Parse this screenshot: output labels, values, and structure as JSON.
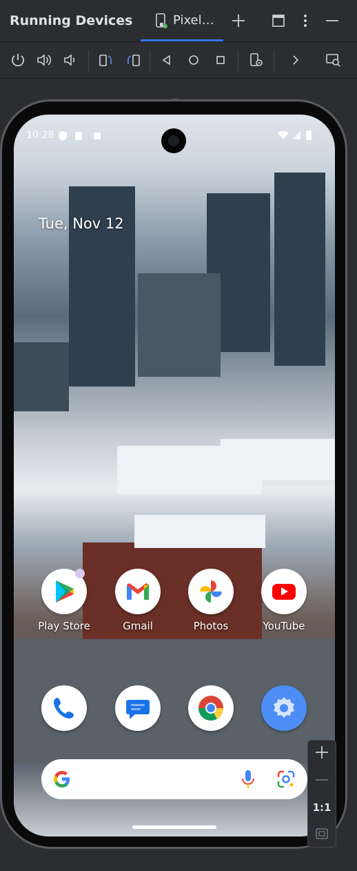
{
  "panel": {
    "title": "Running Devices",
    "tab_label": "Pixel…"
  },
  "toolbar": {
    "items": [
      "power-icon",
      "volume-up-icon",
      "volume-down-icon",
      "rotate-left-icon",
      "rotate-right-icon",
      "back-icon",
      "home-icon",
      "overview-icon",
      "device-settings-icon",
      "more-icon",
      "screen-record-icon"
    ]
  },
  "status_bar": {
    "time": "10:28"
  },
  "home": {
    "date": "Tue, Nov 12",
    "apps": [
      {
        "label": "Play Store",
        "icon": "play-store-icon"
      },
      {
        "label": "Gmail",
        "icon": "gmail-icon"
      },
      {
        "label": "Photos",
        "icon": "photos-icon"
      },
      {
        "label": "YouTube",
        "icon": "youtube-icon"
      }
    ],
    "dock": [
      {
        "icon": "phone-icon"
      },
      {
        "icon": "messages-icon"
      },
      {
        "icon": "chrome-icon"
      },
      {
        "icon": "settings-icon"
      }
    ]
  },
  "zoom": {
    "one_to_one": "1:1"
  },
  "colors": {
    "accent": "#3574f0",
    "panel_bg": "#2b2d30"
  }
}
